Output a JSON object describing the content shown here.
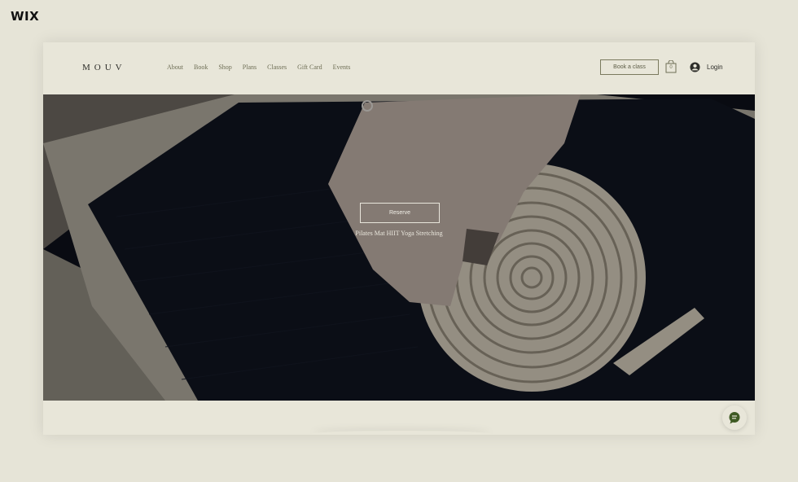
{
  "wix_logo": "WIX",
  "header": {
    "brand": "MOUV",
    "nav": [
      "About",
      "Book",
      "Shop",
      "Plans",
      "Classes",
      "Gift Card",
      "Events"
    ],
    "book_button": "Book a class",
    "cart_count": "0",
    "login_label": "Login"
  },
  "hero": {
    "reserve_button": "Reserve",
    "tagline": "Pilates Mat HIIT Yoga Stretching"
  },
  "icons": {
    "cart": "shopping-bag-icon",
    "avatar": "user-avatar-icon",
    "chat": "chat-bubble-icon"
  },
  "colors": {
    "page_bg": "#e6e4d7",
    "accent": "#3f5b24",
    "text_muted": "#6e6e55"
  }
}
